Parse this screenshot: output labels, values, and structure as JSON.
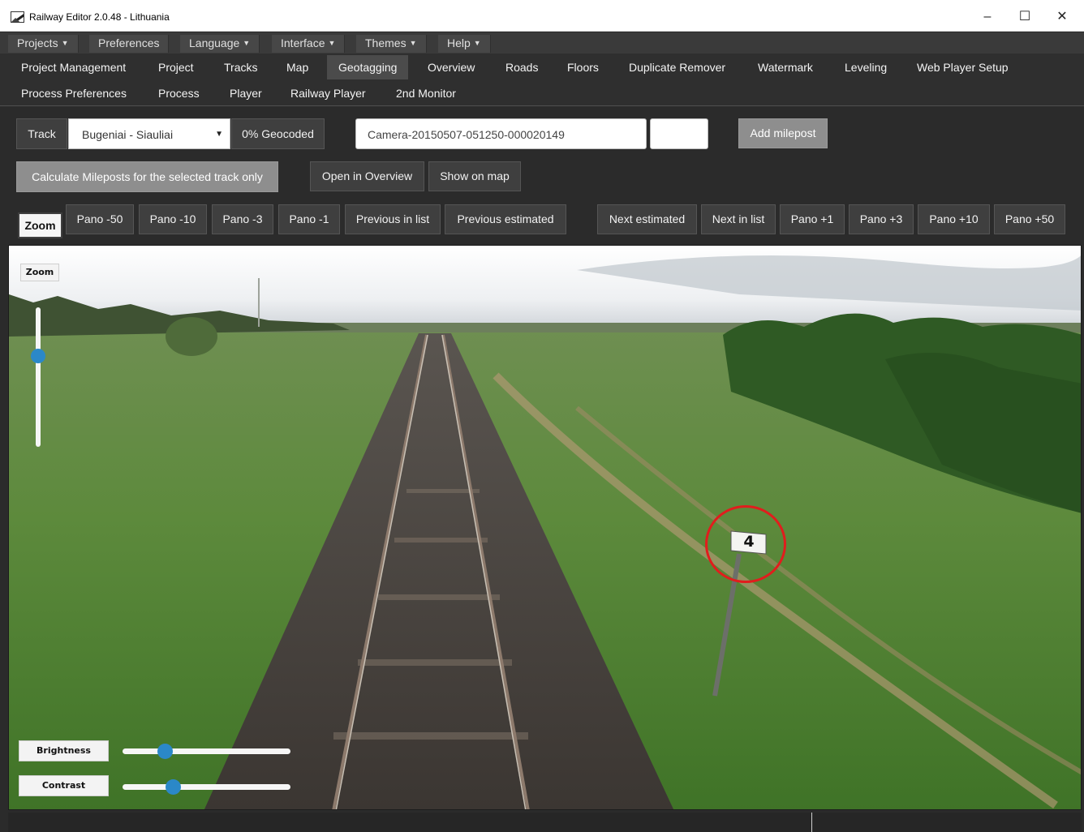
{
  "window": {
    "title": "Railway Editor 2.0.48 - Lithuania",
    "minimize": "–",
    "maximize": "☐",
    "close": "✕"
  },
  "menu": {
    "items": [
      {
        "label": "Projects",
        "caret": "▼"
      },
      {
        "label": "Preferences",
        "caret": ""
      },
      {
        "label": "Language",
        "caret": "▼"
      },
      {
        "label": "Interface",
        "caret": "▼"
      },
      {
        "label": "Themes",
        "caret": "▼"
      },
      {
        "label": "Help",
        "caret": "▼"
      }
    ]
  },
  "tabs": {
    "row1": [
      "Project Management",
      "Project",
      "Tracks",
      "Map",
      "Geotagging",
      "Overview",
      "Roads",
      "Floors",
      "Duplicate Remover",
      "Watermark",
      "Leveling",
      "Web Player Setup"
    ],
    "row2": [
      "Process Preferences",
      "Process",
      "Player",
      "Railway Player",
      "2nd Monitor"
    ],
    "active": "Geotagging"
  },
  "controls": {
    "track_label": "Track",
    "track_value": "Bugeniai - Siauliai",
    "geocoded": "0% Geocoded",
    "camera_value": "Camera-20150507-051250-000020149",
    "milepost_value": "",
    "add_milepost": "Add milepost",
    "calculate": "Calculate Mileposts for the selected track only",
    "open_overview": "Open in Overview",
    "show_on_map": "Show on map"
  },
  "nav": {
    "zoom": "Zoom",
    "pano_m50": "Pano -50",
    "pano_m10": "Pano -10",
    "pano_m3": "Pano -3",
    "pano_m1": "Pano -1",
    "previous_in_list": "Previous in list",
    "previous_estimated": "Previous estimated",
    "next_estimated": "Next estimated",
    "next_in_list": "Next in list",
    "pano_p1": "Pano +1",
    "pano_p3": "Pano +3",
    "pano_p10": "Pano +10",
    "pano_p50": "Pano +50"
  },
  "viewer": {
    "zoom_label": "Zoom",
    "zoom_level": 0.35,
    "brightness_label": "Brightness",
    "brightness_value": 0.25,
    "contrast_label": "Contrast",
    "contrast_value": 0.3,
    "milepost_number": "4",
    "highlight_color": "#e11d1d"
  },
  "theme": {
    "accent": "#2b88c8"
  }
}
